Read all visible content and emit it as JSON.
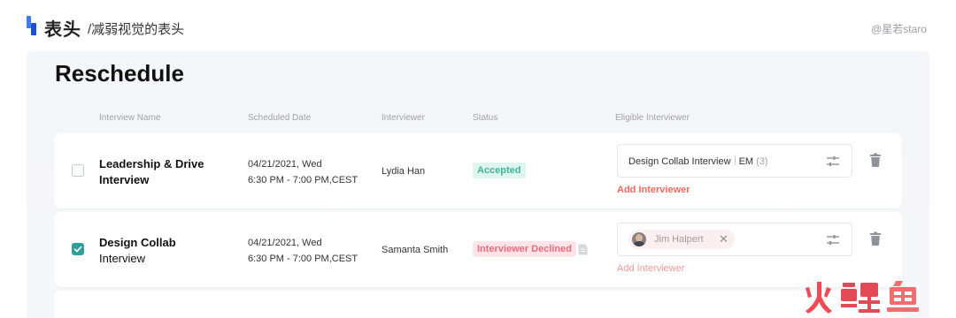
{
  "header": {
    "title": "表头",
    "subtitle": "/减弱视觉的表头",
    "credit": "@星若staro"
  },
  "panel": {
    "title": "Reschedule",
    "columns": {
      "name": "Interview Name",
      "date": "Scheduled Date",
      "interviewer": "Interviewer",
      "status": "Status",
      "eligible": "Eligible Interviewer"
    }
  },
  "rows": [
    {
      "checked": false,
      "name": "Leadership & Drive Interview",
      "date_line1": "04/21/2021, Wed",
      "date_line2": "6:30 PM - 7:00 PM,CEST",
      "interviewer": "Lydia Han",
      "status": "Accepted",
      "eligible_main": "Design Collab Interview",
      "eligible_role": "EM",
      "eligible_count": "(3)",
      "add_label": "Add Interviewer"
    },
    {
      "checked": true,
      "name_bold": "Design Collab",
      "name_rest": "Interview",
      "date_line1": "04/21/2021, Wed",
      "date_line2": "6:30 PM - 7:00 PM,CEST",
      "interviewer": "Samanta Smith",
      "status": "Interviewer Declined",
      "chip_name": "Jim Halpert",
      "chip_close": "✕",
      "add_label": "Add Interviewer"
    }
  ],
  "colors": {
    "accent_blue": "#3d7cf5",
    "accepted": "#3fb597",
    "declined": "#ef6a7a",
    "add_link": "#f06a5e",
    "checked": "#2f9e9c"
  },
  "icons": [
    "brand-mark-icon",
    "checkmark-icon",
    "document-icon",
    "sliders-icon",
    "trash-icon",
    "close-icon"
  ],
  "watermark": {
    "logo_text": "火鲤鱼"
  }
}
